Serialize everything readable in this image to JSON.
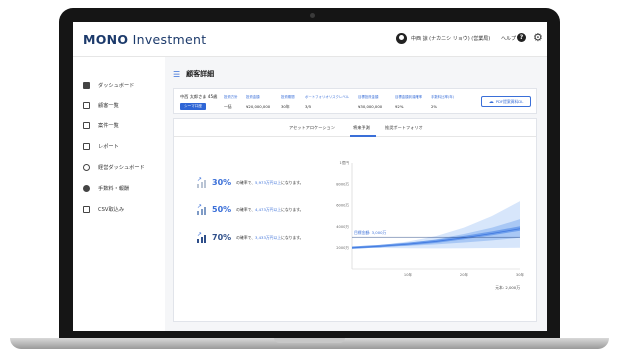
{
  "header": {
    "brand_bold": "MONO",
    "brand_rest": " Investment",
    "user_name": "中西 諒 (ナカニシ リョウ) (営業局)",
    "help_label": "ヘルプ",
    "help_icon_glyph": "?",
    "settings_icon_glyph": "⚙"
  },
  "sidebar": {
    "items": [
      {
        "label": "ダッシュボード",
        "icon": "dashboard-icon"
      },
      {
        "label": "顧客一覧",
        "icon": "list-icon"
      },
      {
        "label": "案件一覧",
        "icon": "cases-icon"
      },
      {
        "label": "レポート",
        "icon": "report-icon"
      },
      {
        "label": "経営ダッシュボード",
        "icon": "org-chart-icon"
      },
      {
        "label": "手数料・報酬",
        "icon": "fee-icon"
      },
      {
        "label": "CSV取込み",
        "icon": "import-icon"
      }
    ]
  },
  "page": {
    "title_icon_glyph": "☰",
    "title": "顧客詳細"
  },
  "customer": {
    "name": "中西 太郎さま 45歳",
    "badge": "シーマ口座",
    "fields": [
      {
        "label": "投資方針",
        "value": "一括"
      },
      {
        "label": "投資金額",
        "value": "¥20,000,000"
      },
      {
        "label": "投資期間",
        "value": "30年"
      },
      {
        "label": "ポートフォリオリスクレベル",
        "value": "3/5"
      },
      {
        "label": "目標投資金額",
        "value": "¥30,000,000"
      },
      {
        "label": "目標金額到達確率",
        "value": "92%"
      },
      {
        "label": "手数料比率(年)",
        "value": "2%"
      }
    ],
    "pdf_button": "PDF提案資料DL",
    "pdf_icon_glyph": "☁"
  },
  "tabs": [
    {
      "label": "アセットアロケーション",
      "active": false
    },
    {
      "label": "将来予測",
      "active": true
    },
    {
      "label": "推奨ポートフォリオ",
      "active": false
    }
  ],
  "probabilities": [
    {
      "pct": "30%",
      "prefix": "の確率で、",
      "amount": "5,973万円以上",
      "suffix": "になります。"
    },
    {
      "pct": "50%",
      "prefix": "の確率で、",
      "amount": "4,473万円以上",
      "suffix": "になります。"
    },
    {
      "pct": "70%",
      "prefix": "の確率で、",
      "amount": "3,433万円以上",
      "suffix": "になります。"
    }
  ],
  "colors": {
    "accent": "#3a6fd8",
    "dark_accent": "#2f4f8a",
    "band_outer": "#d7e6fb",
    "band_mid": "#a9c8f5",
    "band_inner": "#6f9fec",
    "median": "#3f78e0"
  },
  "chart_data": {
    "type": "area",
    "x_ticks": [
      "10年",
      "20年",
      "30年"
    ],
    "y_ticks": [
      "1億円",
      "8000万",
      "6000万",
      "4000万",
      "2000万",
      "1億"
    ],
    "target_label": "目標金額: 3,000万",
    "target_value": 3000,
    "start_value": 2000,
    "principal_note": "元本: 2,000万",
    "x": [
      0,
      5,
      10,
      15,
      20,
      25,
      30
    ],
    "series": [
      {
        "values_upper_outer": [
          2000,
          2250,
          2600,
          3100,
          3900,
          5000,
          6400
        ]
      },
      {
        "values_upper_mid": [
          2000,
          2200,
          2450,
          2800,
          3300,
          3900,
          4700
        ]
      },
      {
        "values_median": [
          2000,
          2150,
          2350,
          2600,
          2950,
          3350,
          3800
        ]
      },
      {
        "values_lower_mid": [
          2000,
          2080,
          2180,
          2320,
          2500,
          2700,
          2950
        ]
      },
      {
        "values_lower_outer": [
          2000,
          1980,
          1960,
          1950,
          1960,
          1980,
          2000
        ]
      }
    ],
    "ylim": [
      0,
      10000
    ]
  }
}
